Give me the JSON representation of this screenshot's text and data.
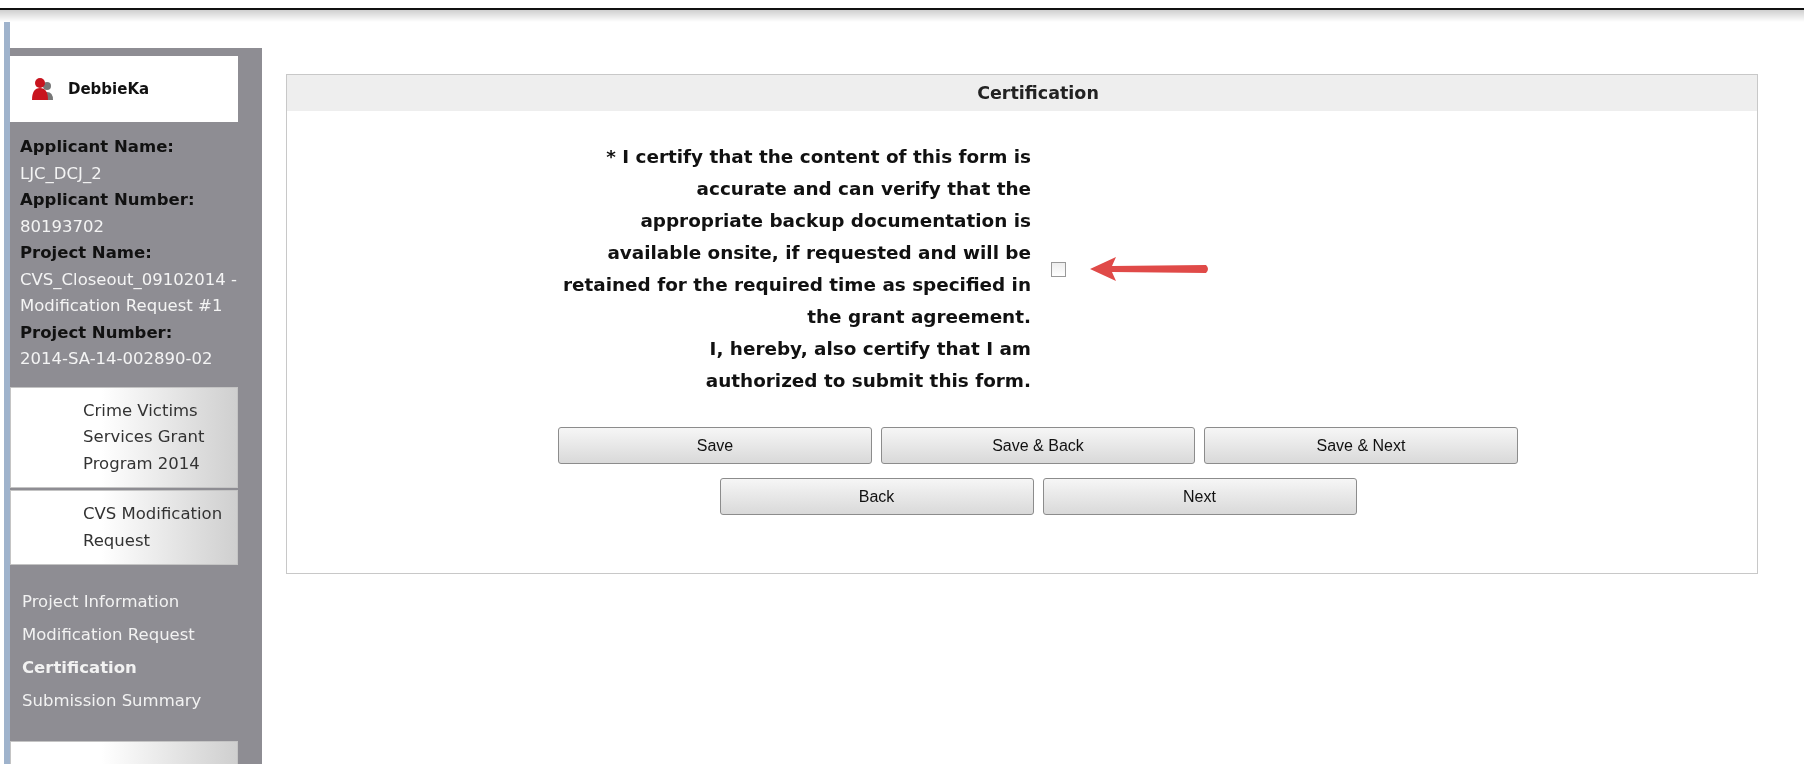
{
  "user": {
    "name": "DebbieKa"
  },
  "applicant": [
    {
      "label": "Applicant Name:",
      "value": "LJC_DCJ_2"
    },
    {
      "label": "Applicant Number:",
      "value": "80193702"
    },
    {
      "label": "Project Name:",
      "value": "CVS_Closeout_09102014 - Modification Request #1"
    },
    {
      "label": "Project Number:",
      "value": "2014-SA-14-002890-02"
    }
  ],
  "nav_cards": [
    {
      "label": "Crime Victims Services Grant Program 2014"
    },
    {
      "label": "CVS Modification Request"
    }
  ],
  "nav_links": [
    {
      "label": "Project Information",
      "selected": false
    },
    {
      "label": "Modification Request",
      "selected": false
    },
    {
      "label": "Certification",
      "selected": true
    },
    {
      "label": "Submission Summary",
      "selected": false
    }
  ],
  "panel": {
    "title": "Certification",
    "statement_lines": [
      "* I certify that the content of this form is",
      "accurate and can verify that the",
      "appropriate backup documentation is",
      "available onsite, if requested and will be",
      "retained for the required time as specified in",
      "the grant agreement.",
      "I, hereby, also certify that I am",
      "authorized to submit this form."
    ],
    "checked": false,
    "button_rows": [
      [
        "Save",
        "Save & Back",
        "Save & Next"
      ],
      [
        "Back",
        "Next"
      ]
    ]
  }
}
